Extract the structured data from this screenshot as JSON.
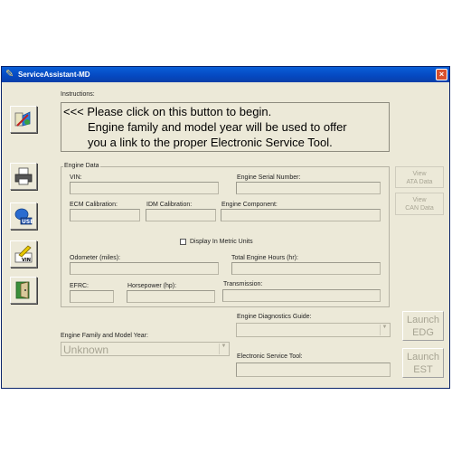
{
  "window": {
    "title": "ServiceAssistant-MD",
    "close_label": "×"
  },
  "instructions": {
    "label": "Instructions:",
    "line1": "<<< Please click on this button to begin.",
    "line2": "Engine family and model year will be used to offer",
    "line3": "you a link to the proper Electronic Service Tool."
  },
  "engine_data": {
    "title": "Engine Data",
    "vin_label": "VIN:",
    "serial_label": "Engine Serial Number:",
    "ecm_label": "ECM Calibration:",
    "idm_label": "IDM Calibration:",
    "component_label": "Engine Component:",
    "metric_label": "Display In Metric Units",
    "metric_checked": false,
    "odometer_label": "Odometer (miles):",
    "hours_label": "Total Engine Hours (hr):",
    "efrc_label": "EFRC:",
    "hp_label": "Horsepower (hp):",
    "transmission_label": "Transmission:"
  },
  "right_buttons": {
    "ata_line1": "View",
    "ata_line2": "ATA Data",
    "can_line1": "View",
    "can_line2": "CAN Data"
  },
  "bottom": {
    "family_label": "Engine Family and Model Year:",
    "family_value": "Unknown",
    "edg_label": "Engine Diagnostics Guide:",
    "est_label": "Electronic Service Tool:",
    "launch_edg_1": "Launch",
    "launch_edg_2": "EDG",
    "launch_est_1": "Launch",
    "launch_est_2": "EST"
  },
  "icons": {
    "start": "wizard-start-icon",
    "print": "printer-icon",
    "usb": "usb-icon",
    "vin": "vin-pen-icon",
    "exit": "exit-door-icon"
  }
}
